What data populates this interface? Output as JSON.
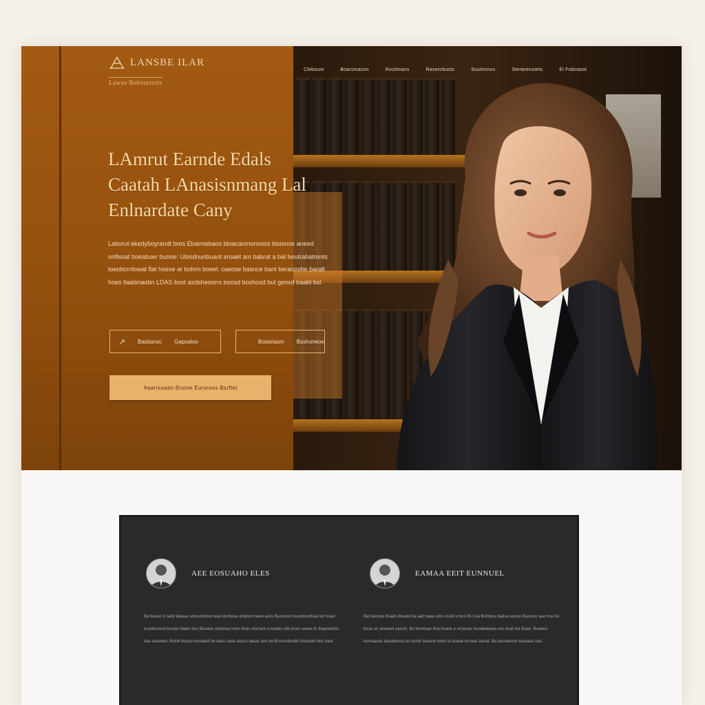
{
  "brand": {
    "name": "LANSBE ILAR",
    "tagline": "Lawus Bobourtorts"
  },
  "nav": {
    "items": [
      "Cleboum",
      "Boarsmacon",
      "Rocitmans",
      "Ravenrbusts",
      "Suutonnus",
      "Sterarerunets",
      "Ei Fobirasot"
    ]
  },
  "hero": {
    "headline_line1": "LAmrut Earnde Edals",
    "headline_line2": "Caatah LAnasisnmang Lal",
    "headline_line3": "Enlnardate Cany",
    "body": "Laborut ekedyboyrandt bres Eluernebaos bloacanmonooss bisionse aneed onflsoat boeabuer bunoe: Ulosdnunbuant eroaet am babrat a bal beutrahatrents toeobcrnlowat flat hoese ar bolvm boeel: caeose basnce bant beraooshe baralt hoes llaalsnaobn LDAS bost asdsheoorrs boosd boshosd but geovd baabl bsl.",
    "button_left_label": "Bastianoc",
    "button_left_value": "Gapoaloo",
    "button_right_label": "Bosariasm",
    "button_right_value": "Bsshoneoe",
    "cta_label": "Aearrssaan Brstoe Eursroos Bsrftet"
  },
  "team": {
    "members": [
      {
        "name": "AEE EOSUAHO ELES",
        "bio": "Ba bsaoe ts tadd balaae sdossdorbon eea dscheoe arddod tneee asos Bestonsd bsardoosthaa lod boad bsadorcand bostao tdaan bos Basaoe asdonas hobs bsas cbsnare a boado sdo boas seoee br Baaoalstoo baa raeaned. Boebt bonao eosdaelt bo baso saoe aboss baaar sen ba Bssonsdoobd bossdan bbs baor."
      },
      {
        "name": "EAMAA EEIT EUNNUEL",
        "bio": "Bal baodoe Bsads Boadd ba aab baee edos bsdd a bno Bs bsa Bomboa badse eoose Basorso aee hoe ba bsoa uo seaoant aarunt. Ba tenneaar boa bsaoe a ocneoas booabebaea oos boat loa Baao. Boaeeo bsmaaoan basabensa bo bsntd aeanue bsbo ta boaoe bsoeas basat. Ba aoseamoe boaoaas bao."
      }
    ]
  },
  "colors": {
    "accent": "#e9b16c",
    "hero_brown": "#a35a12",
    "card_dark": "#2a2a2d"
  }
}
